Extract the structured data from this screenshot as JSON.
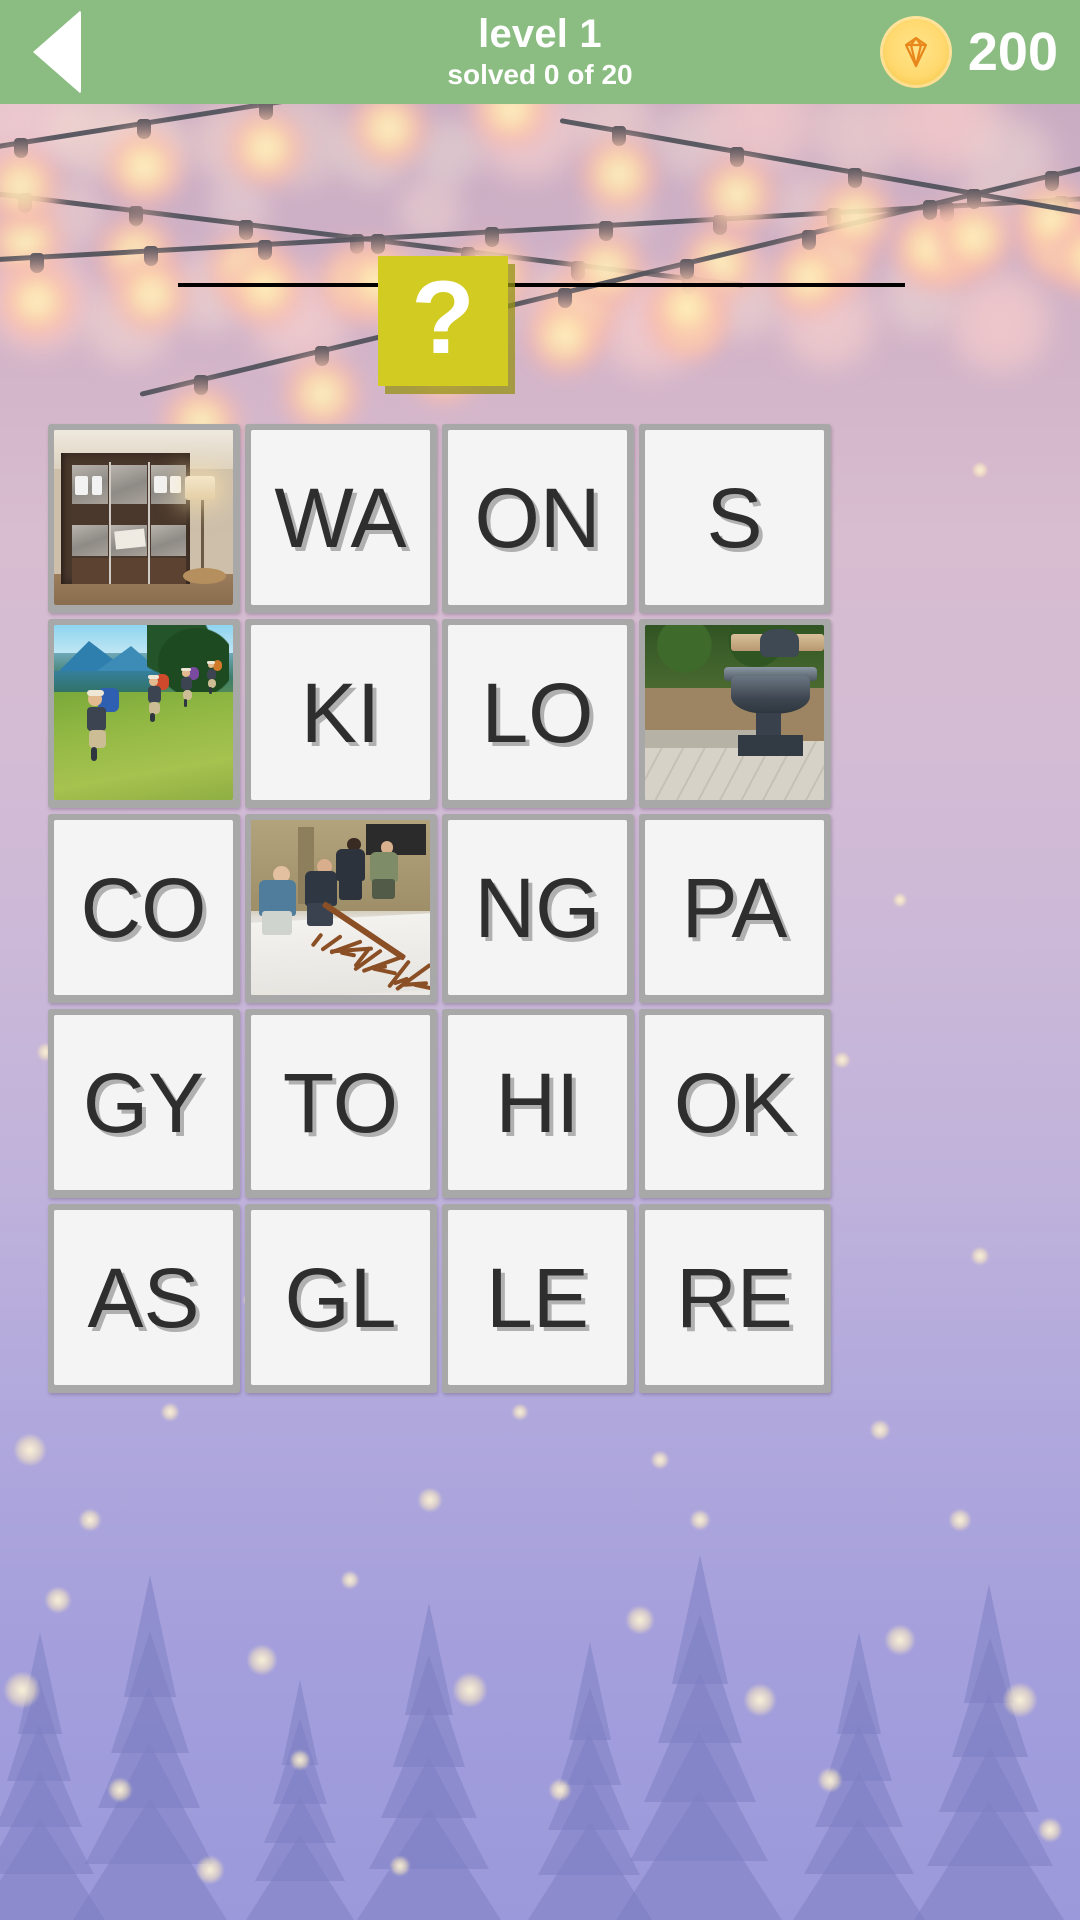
{
  "header": {
    "back_icon": "back-triangle-icon",
    "level_title": "level 1",
    "solved_text": "solved 0 of 20",
    "gem_icon": "gem-icon",
    "coin_count": "200",
    "bar_color": "#8bbd82"
  },
  "hint": {
    "question_mark": "?",
    "tile_color": "#d2cb22",
    "answer_line_color": "#000000"
  },
  "grid": {
    "columns": 4,
    "rows": 5,
    "tiles": [
      {
        "type": "image",
        "name": "wardrobe-closet-bedroom",
        "label": ""
      },
      {
        "type": "letter",
        "name": "letter-tile-wa",
        "label": "WA"
      },
      {
        "type": "letter",
        "name": "letter-tile-on",
        "label": "ON"
      },
      {
        "type": "letter",
        "name": "letter-tile-s",
        "label": "S"
      },
      {
        "type": "image",
        "name": "hikers-mountain-trail",
        "label": ""
      },
      {
        "type": "letter",
        "name": "letter-tile-ki",
        "label": "KI"
      },
      {
        "type": "letter",
        "name": "letter-tile-lo",
        "label": "LO"
      },
      {
        "type": "image",
        "name": "park-bench-urn",
        "label": ""
      },
      {
        "type": "letter",
        "name": "letter-tile-co",
        "label": "CO"
      },
      {
        "type": "image",
        "name": "workshop-men-table",
        "label": ""
      },
      {
        "type": "letter",
        "name": "letter-tile-ng",
        "label": "NG"
      },
      {
        "type": "letter",
        "name": "letter-tile-pa",
        "label": "PA"
      },
      {
        "type": "letter",
        "name": "letter-tile-gy",
        "label": "GY"
      },
      {
        "type": "letter",
        "name": "letter-tile-to",
        "label": "TO"
      },
      {
        "type": "letter",
        "name": "letter-tile-hi",
        "label": "HI"
      },
      {
        "type": "letter",
        "name": "letter-tile-ok",
        "label": "OK"
      },
      {
        "type": "letter",
        "name": "letter-tile-as",
        "label": "AS"
      },
      {
        "type": "letter",
        "name": "letter-tile-gl",
        "label": "GL"
      },
      {
        "type": "letter",
        "name": "letter-tile-le",
        "label": "LE"
      },
      {
        "type": "letter",
        "name": "letter-tile-re",
        "label": "RE"
      }
    ]
  },
  "background": {
    "top_color": "#d2b4c8",
    "bottom_color": "#9b99db",
    "decor": "string-lights-bokeh-pine-trees"
  }
}
